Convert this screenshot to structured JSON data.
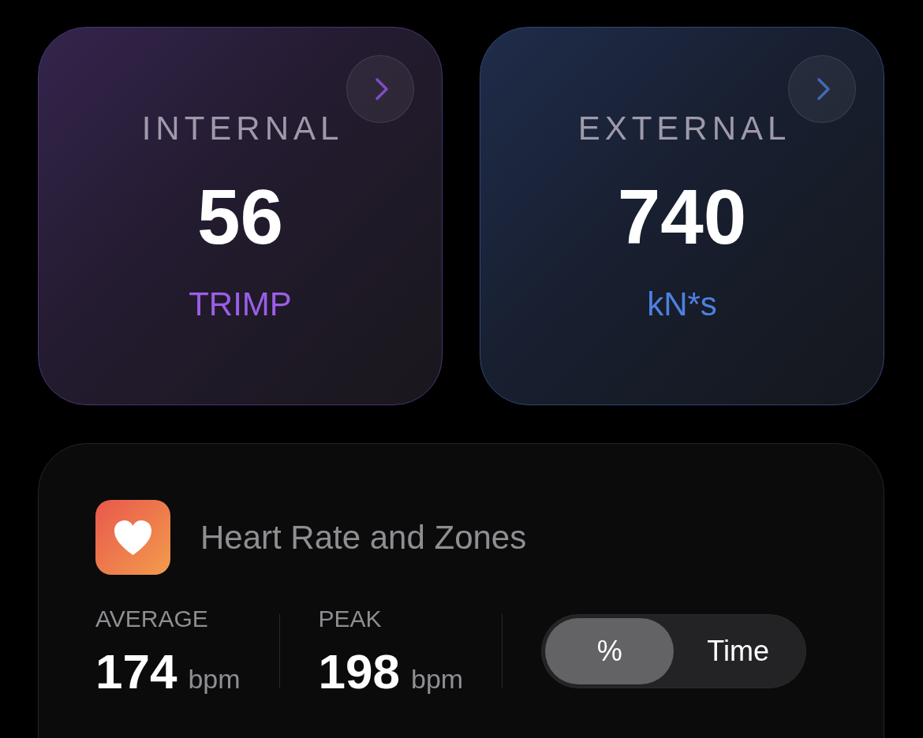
{
  "metric_cards": [
    {
      "kind": "internal",
      "label": "INTERNAL",
      "value": "56",
      "unit": "TRIMP"
    },
    {
      "kind": "external",
      "label": "EXTERNAL",
      "value": "740",
      "unit": "kN*s"
    }
  ],
  "heart_rate_card": {
    "title": "Heart Rate and Zones",
    "stats": [
      {
        "label": "AVERAGE",
        "value": "174",
        "unit": "bpm"
      },
      {
        "label": "PEAK",
        "value": "198",
        "unit": "bpm"
      }
    ],
    "toggle": [
      {
        "label": "%",
        "selected": true
      },
      {
        "label": "Time",
        "selected": false
      }
    ]
  }
}
